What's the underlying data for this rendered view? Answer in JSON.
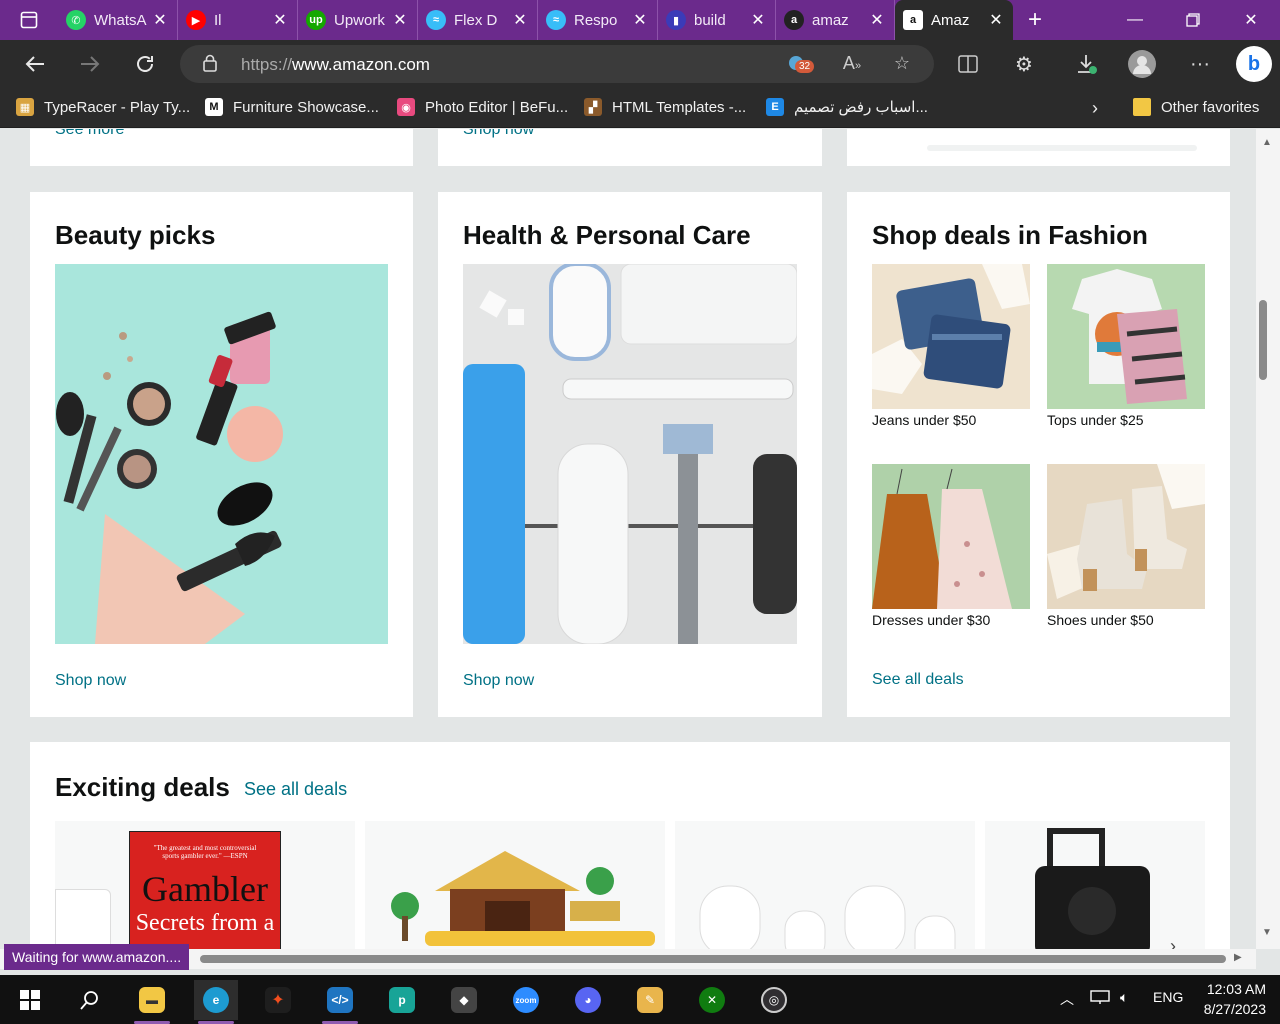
{
  "browser": {
    "tabs": [
      {
        "label": "WhatsApp",
        "icon": "whatsapp-icon",
        "color": "#25d366",
        "glyph": "✆"
      },
      {
        "label": "Il",
        "icon": "youtube-icon",
        "color": "#ff0000",
        "glyph": "▶"
      },
      {
        "label": "Upwork",
        "icon": "upwork-icon",
        "color": "#14a800",
        "glyph": "up"
      },
      {
        "label": "Flex D",
        "icon": "tailwind-icon",
        "color": "#38bdf8",
        "glyph": "≈"
      },
      {
        "label": "Respo",
        "icon": "tailwind-icon",
        "color": "#38bdf8",
        "glyph": "≈"
      },
      {
        "label": "build",
        "icon": "page-icon",
        "color": "#3b3bb8",
        "glyph": "▮"
      },
      {
        "label": "amaz",
        "icon": "amazon-icon",
        "color": "#222222",
        "glyph": "a"
      }
    ],
    "active_tab": {
      "label": "Amaz",
      "icon": "amazon-icon"
    },
    "url_scheme": "https://",
    "url_host": "www.amazon.com",
    "tracker_badge": "32",
    "favorites": [
      {
        "label": "TypeRacer - Play Ty...",
        "glyph": "▦",
        "color": "#d9a441"
      },
      {
        "label": "Furniture Showcase...",
        "glyph": "M",
        "color": "#ffffff"
      },
      {
        "label": "Photo Editor | BeFu...",
        "glyph": "◉",
        "color": "#e84a7f"
      },
      {
        "label": "HTML Templates -...",
        "glyph": "▞",
        "color": "#8b5a2b"
      },
      {
        "label": "اسباب رفض تصميم...",
        "glyph": "E",
        "color": "#1e88e5"
      }
    ],
    "other_favorites": "Other favorites",
    "status_text": "Waiting for www.amazon...."
  },
  "page": {
    "top_links": [
      "See more",
      "Shop now"
    ],
    "cards": {
      "beauty": {
        "title": "Beauty picks",
        "link": "Shop now"
      },
      "health": {
        "title": "Health & Personal Care",
        "link": "Shop now"
      },
      "fashion": {
        "title": "Shop deals in Fashion",
        "items": [
          {
            "caption": "Jeans under $50"
          },
          {
            "caption": "Tops under $25"
          },
          {
            "caption": "Dresses under $30"
          },
          {
            "caption": "Shoes under $50"
          }
        ],
        "link": "See all deals"
      }
    },
    "deals": {
      "title": "Exciting deals",
      "link": "See all deals",
      "book_title": "Gambler",
      "book_subtitle": "Secrets from a",
      "book_blurb": "\"The greatest and most controversial sports gambler ever.\" —ESPN"
    }
  },
  "taskbar": {
    "language": "ENG",
    "time": "12:03 AM",
    "date": "8/27/2023"
  }
}
